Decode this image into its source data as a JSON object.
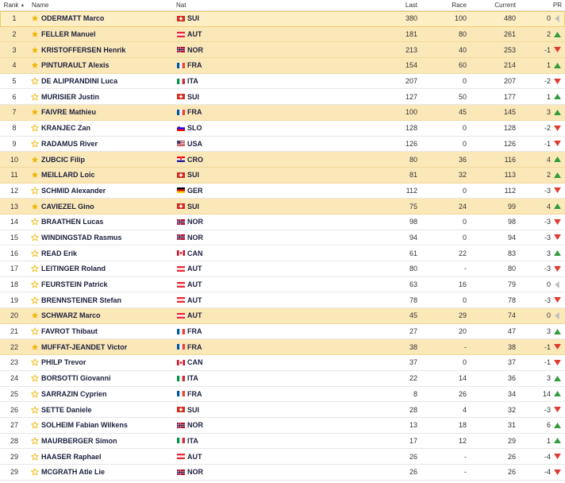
{
  "header": {
    "rank": "Rank",
    "name": "Name",
    "nat": "Nat",
    "last": "Last",
    "race": "Race",
    "current": "Current",
    "pr": "PR"
  },
  "colors": {
    "star_filled": "#f2b705",
    "star_outline": "#f2b705",
    "highlight_row": "#fbe8b9",
    "up_arrow": "#2e9d3a",
    "down_arrow": "#e03a2f",
    "neutral_arrow": "#bdbdbd"
  },
  "rows": [
    {
      "rank": "1",
      "name": "ODERMATT Marco",
      "nat": "SUI",
      "flag": "sui",
      "last": "380",
      "race": "100",
      "current": "480",
      "pr": "0",
      "trend": "neutral",
      "fav": true
    },
    {
      "rank": "2",
      "name": "FELLER Manuel",
      "nat": "AUT",
      "flag": "aut",
      "last": "181",
      "race": "80",
      "current": "261",
      "pr": "2",
      "trend": "up",
      "fav": true
    },
    {
      "rank": "3",
      "name": "KRISTOFFERSEN Henrik",
      "nat": "NOR",
      "flag": "nor",
      "last": "213",
      "race": "40",
      "current": "253",
      "pr": "-1",
      "trend": "down",
      "fav": true
    },
    {
      "rank": "4",
      "name": "PINTURAULT Alexis",
      "nat": "FRA",
      "flag": "fra",
      "last": "154",
      "race": "60",
      "current": "214",
      "pr": "1",
      "trend": "up",
      "fav": true
    },
    {
      "rank": "5",
      "name": "DE ALIPRANDINI Luca",
      "nat": "ITA",
      "flag": "ita",
      "last": "207",
      "race": "0",
      "current": "207",
      "pr": "-2",
      "trend": "down",
      "fav": false
    },
    {
      "rank": "6",
      "name": "MURISIER Justin",
      "nat": "SUI",
      "flag": "sui",
      "last": "127",
      "race": "50",
      "current": "177",
      "pr": "1",
      "trend": "up",
      "fav": false
    },
    {
      "rank": "7",
      "name": "FAIVRE Mathieu",
      "nat": "FRA",
      "flag": "fra",
      "last": "100",
      "race": "45",
      "current": "145",
      "pr": "3",
      "trend": "up",
      "fav": true
    },
    {
      "rank": "8",
      "name": "KRANJEC Zan",
      "nat": "SLO",
      "flag": "slo",
      "last": "128",
      "race": "0",
      "current": "128",
      "pr": "-2",
      "trend": "down",
      "fav": false
    },
    {
      "rank": "9",
      "name": "RADAMUS River",
      "nat": "USA",
      "flag": "usa",
      "last": "126",
      "race": "0",
      "current": "126",
      "pr": "-1",
      "trend": "down",
      "fav": false
    },
    {
      "rank": "10",
      "name": "ZUBCIC Filip",
      "nat": "CRO",
      "flag": "cro",
      "last": "80",
      "race": "36",
      "current": "116",
      "pr": "4",
      "trend": "up",
      "fav": true
    },
    {
      "rank": "11",
      "name": "MEILLARD Loic",
      "nat": "SUI",
      "flag": "sui",
      "last": "81",
      "race": "32",
      "current": "113",
      "pr": "2",
      "trend": "up",
      "fav": true
    },
    {
      "rank": "12",
      "name": "SCHMID Alexander",
      "nat": "GER",
      "flag": "ger",
      "last": "112",
      "race": "0",
      "current": "112",
      "pr": "-3",
      "trend": "down",
      "fav": false
    },
    {
      "rank": "13",
      "name": "CAVIEZEL Gino",
      "nat": "SUI",
      "flag": "sui",
      "last": "75",
      "race": "24",
      "current": "99",
      "pr": "4",
      "trend": "up",
      "fav": true
    },
    {
      "rank": "14",
      "name": "BRAATHEN Lucas",
      "nat": "NOR",
      "flag": "nor",
      "last": "98",
      "race": "0",
      "current": "98",
      "pr": "-3",
      "trend": "down",
      "fav": false
    },
    {
      "rank": "15",
      "name": "WINDINGSTAD Rasmus",
      "nat": "NOR",
      "flag": "nor",
      "last": "94",
      "race": "0",
      "current": "94",
      "pr": "-3",
      "trend": "down",
      "fav": false
    },
    {
      "rank": "16",
      "name": "READ Erik",
      "nat": "CAN",
      "flag": "can",
      "last": "61",
      "race": "22",
      "current": "83",
      "pr": "3",
      "trend": "up",
      "fav": false
    },
    {
      "rank": "17",
      "name": "LEITINGER Roland",
      "nat": "AUT",
      "flag": "aut",
      "last": "80",
      "race": "-",
      "current": "80",
      "pr": "-3",
      "trend": "down",
      "fav": false
    },
    {
      "rank": "18",
      "name": "FEURSTEIN Patrick",
      "nat": "AUT",
      "flag": "aut",
      "last": "63",
      "race": "16",
      "current": "79",
      "pr": "0",
      "trend": "neutral",
      "fav": false
    },
    {
      "rank": "19",
      "name": "BRENNSTEINER Stefan",
      "nat": "AUT",
      "flag": "aut",
      "last": "78",
      "race": "0",
      "current": "78",
      "pr": "-3",
      "trend": "down",
      "fav": false
    },
    {
      "rank": "20",
      "name": "SCHWARZ Marco",
      "nat": "AUT",
      "flag": "aut",
      "last": "45",
      "race": "29",
      "current": "74",
      "pr": "0",
      "trend": "neutral",
      "fav": true
    },
    {
      "rank": "21",
      "name": "FAVROT Thibaut",
      "nat": "FRA",
      "flag": "fra",
      "last": "27",
      "race": "20",
      "current": "47",
      "pr": "3",
      "trend": "up",
      "fav": false
    },
    {
      "rank": "22",
      "name": "MUFFAT-JEANDET Victor",
      "nat": "FRA",
      "flag": "fra",
      "last": "38",
      "race": "-",
      "current": "38",
      "pr": "-1",
      "trend": "down",
      "fav": true
    },
    {
      "rank": "23",
      "name": "PHILP Trevor",
      "nat": "CAN",
      "flag": "can",
      "last": "37",
      "race": "0",
      "current": "37",
      "pr": "-1",
      "trend": "down",
      "fav": false
    },
    {
      "rank": "24",
      "name": "BORSOTTI Giovanni",
      "nat": "ITA",
      "flag": "ita",
      "last": "22",
      "race": "14",
      "current": "36",
      "pr": "3",
      "trend": "up",
      "fav": false
    },
    {
      "rank": "25",
      "name": "SARRAZIN Cyprien",
      "nat": "FRA",
      "flag": "fra",
      "last": "8",
      "race": "26",
      "current": "34",
      "pr": "14",
      "trend": "up",
      "fav": false
    },
    {
      "rank": "26",
      "name": "SETTE Daniele",
      "nat": "SUI",
      "flag": "sui",
      "last": "28",
      "race": "4",
      "current": "32",
      "pr": "-3",
      "trend": "down",
      "fav": false
    },
    {
      "rank": "27",
      "name": "SOLHEIM Fabian Wilkens",
      "nat": "NOR",
      "flag": "nor",
      "last": "13",
      "race": "18",
      "current": "31",
      "pr": "6",
      "trend": "up",
      "fav": false
    },
    {
      "rank": "28",
      "name": "MAURBERGER Simon",
      "nat": "ITA",
      "flag": "ita",
      "last": "17",
      "race": "12",
      "current": "29",
      "pr": "1",
      "trend": "up",
      "fav": false
    },
    {
      "rank": "29",
      "name": "HAASER Raphael",
      "nat": "AUT",
      "flag": "aut",
      "last": "26",
      "race": "-",
      "current": "26",
      "pr": "-4",
      "trend": "down",
      "fav": false
    },
    {
      "rank": "29",
      "name": "MCGRATH Atle Lie",
      "nat": "NOR",
      "flag": "nor",
      "last": "26",
      "race": "-",
      "current": "26",
      "pr": "-4",
      "trend": "down",
      "fav": false
    }
  ]
}
